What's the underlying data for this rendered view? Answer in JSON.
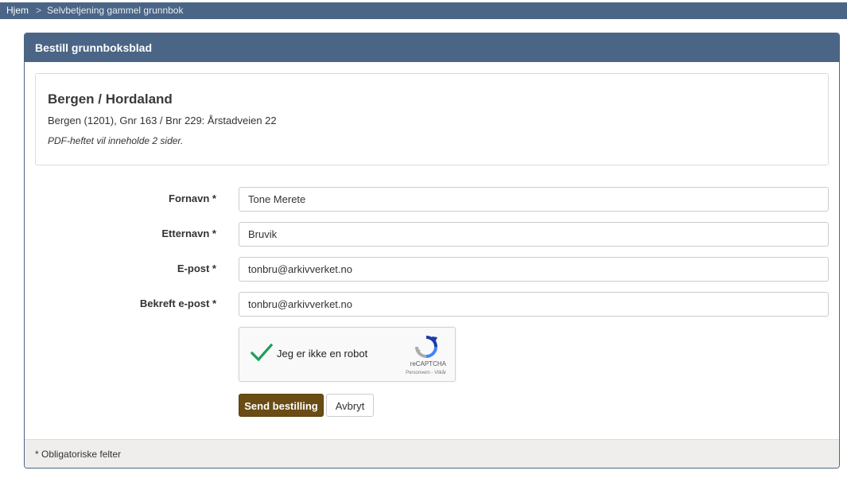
{
  "breadcrumb": {
    "home": "Hjem",
    "separator": ">",
    "current": "Selvbetjening gammel grunnbok"
  },
  "panel": {
    "title": "Bestill grunnboksblad"
  },
  "info": {
    "title": "Bergen / Hordaland",
    "address": "Bergen (1201), Gnr 163 / Bnr 229: Årstadveien 22",
    "note": "PDF-heftet vil inneholde 2 sider."
  },
  "form": {
    "first_name": {
      "label": "Fornavn *",
      "value": "Tone Merete"
    },
    "last_name": {
      "label": "Etternavn *",
      "value": "Bruvik"
    },
    "email": {
      "label": "E-post *",
      "value": "tonbru@arkivverket.no"
    },
    "confirm_email": {
      "label": "Bekreft e-post *",
      "value": "tonbru@arkivverket.no"
    }
  },
  "recaptcha": {
    "label": "Jeg er ikke en robot",
    "brand": "reCAPTCHA",
    "links": "Personvern - Vilkår",
    "checked": true,
    "check_icon": "checkmark-icon",
    "logo_icon": "recaptcha-logo-icon"
  },
  "buttons": {
    "submit": "Send bestilling",
    "cancel": "Avbryt"
  },
  "footer": {
    "note": "* Obligatoriske felter"
  },
  "colors": {
    "header": "#4a6585",
    "primary_button": "#6a4c14",
    "footer_bg": "#efeeec",
    "check": "#1e9e58"
  }
}
